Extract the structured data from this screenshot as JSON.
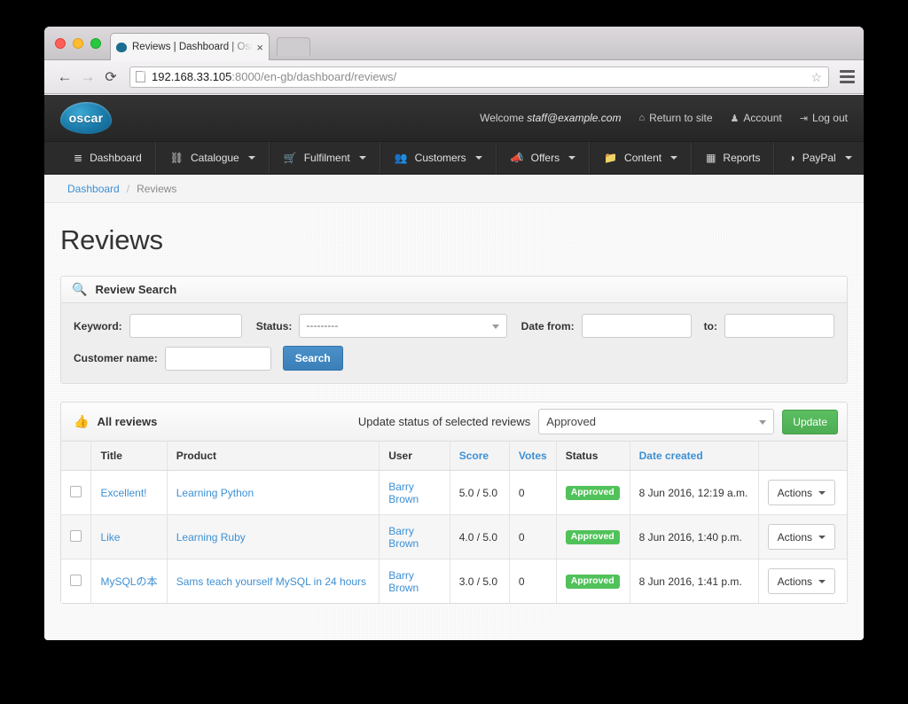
{
  "browser": {
    "tab_title": "Reviews | Dashboard | Osc",
    "tab_close": "×",
    "back_icon": "←",
    "forward_icon": "→",
    "reload_icon": "⟳",
    "url_host": "192.168.33.105",
    "url_path": ":8000/en-gb/dashboard/reviews/",
    "star_icon": "☆"
  },
  "topbar": {
    "logo_text": "oscar",
    "welcome_prefix": "Welcome ",
    "welcome_user": "staff@example.com",
    "links": [
      {
        "label": "Return to site",
        "icon": "⌂"
      },
      {
        "label": "Account",
        "icon": "♟"
      },
      {
        "label": "Log out",
        "icon": "⇥"
      }
    ]
  },
  "nav": {
    "items": [
      {
        "label": "Dashboard",
        "icon": "≣",
        "caret": false
      },
      {
        "label": "Catalogue",
        "icon": "⛓",
        "caret": true
      },
      {
        "label": "Fulfilment",
        "icon": "Ὥ2",
        "caret": true
      },
      {
        "label": "Customers",
        "icon": "♟",
        "caret": true
      },
      {
        "label": "Offers",
        "icon": "◁",
        "caret": true
      },
      {
        "label": "Content",
        "icon": "▰",
        "caret": true
      },
      {
        "label": "Reports",
        "icon": "▦",
        "caret": false
      },
      {
        "label": "PayPal",
        "icon": "◑",
        "caret": true
      }
    ]
  },
  "breadcrumb": {
    "root": "Dashboard",
    "separator": "/",
    "current": "Reviews"
  },
  "page_title": "Reviews",
  "search_panel": {
    "heading": "Review Search",
    "heading_icon": "search-icon",
    "keyword_label": "Keyword:",
    "keyword_value": "",
    "status_label": "Status:",
    "status_value": "---------",
    "date_from_label": "Date from:",
    "date_from_value": "",
    "date_to_label": "to:",
    "date_to_value": "",
    "customer_label": "Customer name:",
    "customer_value": "",
    "search_button": "Search"
  },
  "table_panel": {
    "heading": "All reviews",
    "heading_icon": "thumbs-up-icon",
    "bulk_label": "Update status of selected reviews",
    "bulk_value": "Approved",
    "update_button": "Update",
    "columns": [
      {
        "label": "",
        "link": false
      },
      {
        "label": "Title",
        "link": false
      },
      {
        "label": "Product",
        "link": false
      },
      {
        "label": "User",
        "link": false
      },
      {
        "label": "Score",
        "link": true
      },
      {
        "label": "Votes",
        "link": true
      },
      {
        "label": "Status",
        "link": false
      },
      {
        "label": "Date created",
        "link": true
      },
      {
        "label": "",
        "link": false
      }
    ],
    "actions_label": "Actions",
    "rows": [
      {
        "title": "Excellent!",
        "product": "Learning Python",
        "user": "Barry Brown",
        "score": "5.0 / 5.0",
        "votes": "0",
        "status": "Approved",
        "date": "8 Jun 2016, 12:19 a.m."
      },
      {
        "title": "Like",
        "product": "Learning Ruby",
        "user": "Barry Brown",
        "score": "4.0 / 5.0",
        "votes": "0",
        "status": "Approved",
        "date": "8 Jun 2016, 1:40 p.m."
      },
      {
        "title": "MySQLの本",
        "product": "Sams teach yourself MySQL in 24 hours",
        "user": "Barry Brown",
        "score": "3.0 / 5.0",
        "votes": "0",
        "status": "Approved",
        "date": "8 Jun 2016, 1:41 p.m."
      }
    ]
  },
  "colors": {
    "link": "#3d90d4",
    "success": "#51c25a",
    "primary": "#3b7fb8",
    "topbar": "#2e2e2e"
  }
}
